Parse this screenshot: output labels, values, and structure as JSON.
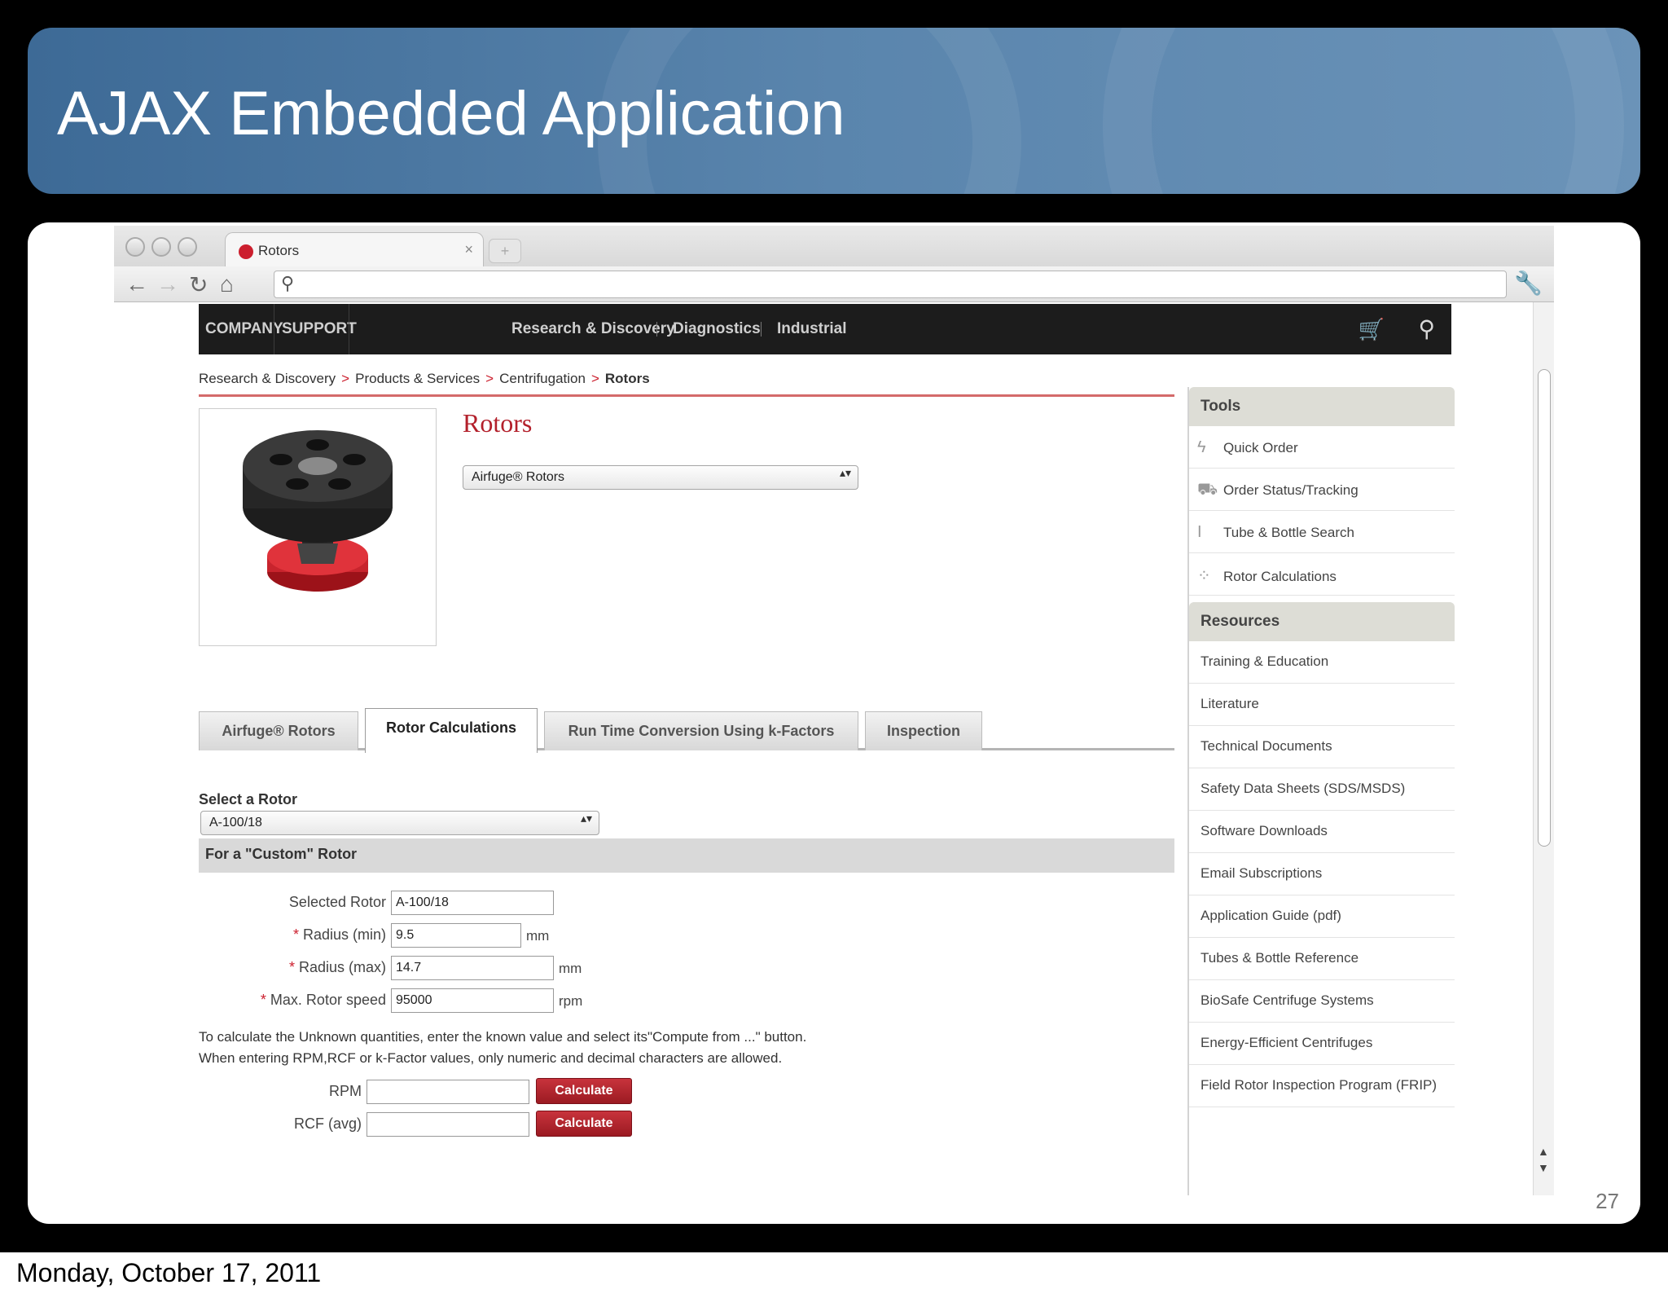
{
  "slide": {
    "title": "AJAX Embedded Application",
    "number": "27",
    "date": "Monday, October 17, 2011"
  },
  "browser": {
    "tab_title": "Rotors",
    "tab_close": "×",
    "new_tab": "+",
    "back_icon": "←",
    "forward_icon": "→",
    "reload_icon": "↻",
    "home_icon": "⌂",
    "search_icon": "⚲",
    "wrench_icon": "🔧"
  },
  "site": {
    "nav_left": [
      "COMPANY",
      "SUPPORT"
    ],
    "nav_center": [
      "Research & Discovery",
      "Diagnostics",
      "Industrial"
    ],
    "breadcrumb": [
      "Research & Discovery",
      "Products & Services",
      "Centrifugation",
      "Rotors"
    ],
    "breadcrumb_sep": ">",
    "page_heading": "Rotors",
    "product_select": "Airfuge® Rotors",
    "select_arrow": "▴▾",
    "tabs": [
      "Airfuge® Rotors",
      "Rotor Calculations",
      "Run Time Conversion Using k-Factors",
      "Inspection"
    ],
    "active_tab": 1,
    "select_rotor_label": "Select a Rotor",
    "rotor_select": "A-100/18",
    "custom_header": "For a \"Custom\" Rotor",
    "form": {
      "selected_rotor_label": "Selected Rotor",
      "selected_rotor_value": "A-100/18",
      "required_mark": "*",
      "radius_min_label": "Radius (min)",
      "radius_min_value": "9.5",
      "radius_min_unit": "mm",
      "radius_max_label": "Radius (max)",
      "radius_max_value": "14.7",
      "radius_max_unit": "mm",
      "max_speed_label": "Max. Rotor speed",
      "max_speed_value": "95000",
      "max_speed_unit": "rpm"
    },
    "instructions": [
      "To calculate the Unknown quantities, enter the known value and select its\"Compute from ...\" button.",
      "When entering RPM,RCF or k-Factor values, only numeric and decimal characters are allowed."
    ],
    "calc": {
      "rpm_label": "RPM",
      "rpm_value": "",
      "rcf_label": "RCF (avg)",
      "rcf_value": "",
      "button_label": "Calculate"
    },
    "sidebar": {
      "tools_header": "Tools",
      "tools": [
        {
          "label": "Quick Order",
          "icon": "ϟ"
        },
        {
          "label": "Order Status/Tracking",
          "icon": "⛟"
        },
        {
          "label": "Tube & Bottle Search",
          "icon": "I"
        },
        {
          "label": "Rotor Calculations",
          "icon": "⁘"
        }
      ],
      "resources_header": "Resources",
      "resources": [
        "Training & Education",
        "Literature",
        "Technical Documents",
        "Safety Data Sheets (SDS/MSDS)",
        "Software Downloads",
        "Email Subscriptions",
        "Application Guide (pdf)",
        "Tubes & Bottle Reference",
        "BioSafe Centrifuge Systems",
        "Energy-Efficient Centrifuges",
        "Field Rotor Inspection Program (FRIP)"
      ]
    },
    "cart_icon": "🛒",
    "nav_search_icon": "⚲",
    "scroll_up": "▲",
    "scroll_down": "▼"
  },
  "colors": {
    "brand_red": "#cc1f2e",
    "title_blue": "#4f7aa3",
    "nav_dark": "#1c1c1c"
  }
}
